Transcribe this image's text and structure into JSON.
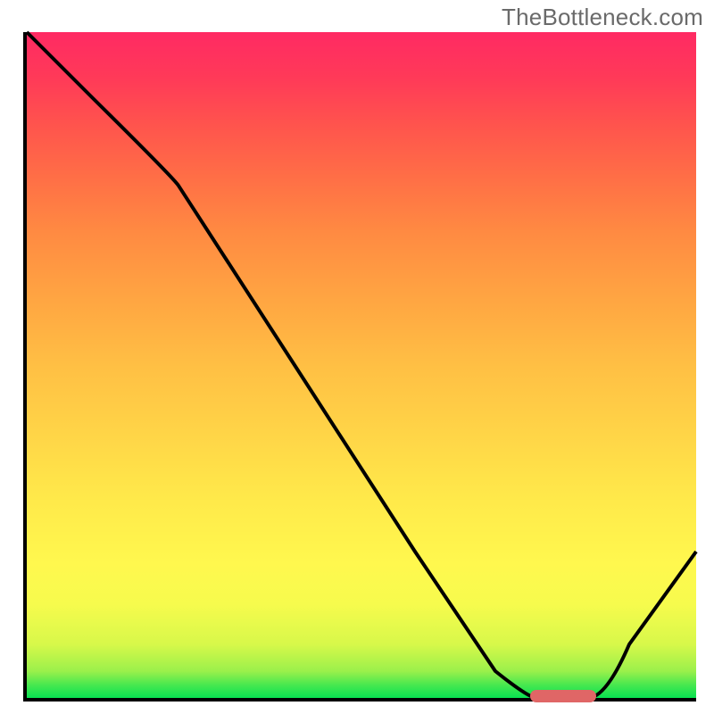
{
  "watermark": "TheBottleneck.com",
  "chart_data": {
    "type": "line",
    "title": "",
    "xlabel": "",
    "ylabel": "",
    "xlim": [
      0,
      100
    ],
    "ylim": [
      0,
      100
    ],
    "grid": false,
    "legend": false,
    "gradient_meaning": "vertical background gradient from green (bottom, good/no-bottleneck) through yellow/orange to red (top, bad/bottleneck)",
    "series": [
      {
        "name": "bottleneck-curve",
        "color": "#000000",
        "x": [
          0,
          10,
          22,
          40,
          58,
          70,
          76,
          80,
          84,
          90,
          100
        ],
        "y": [
          100,
          90,
          78,
          50,
          22,
          4,
          0,
          0,
          0,
          8,
          22
        ]
      }
    ],
    "marker": {
      "name": "optimal-range-marker",
      "color": "#e06666",
      "shape": "rounded-bar",
      "x_start": 76,
      "x_end": 84,
      "y": 0
    }
  }
}
